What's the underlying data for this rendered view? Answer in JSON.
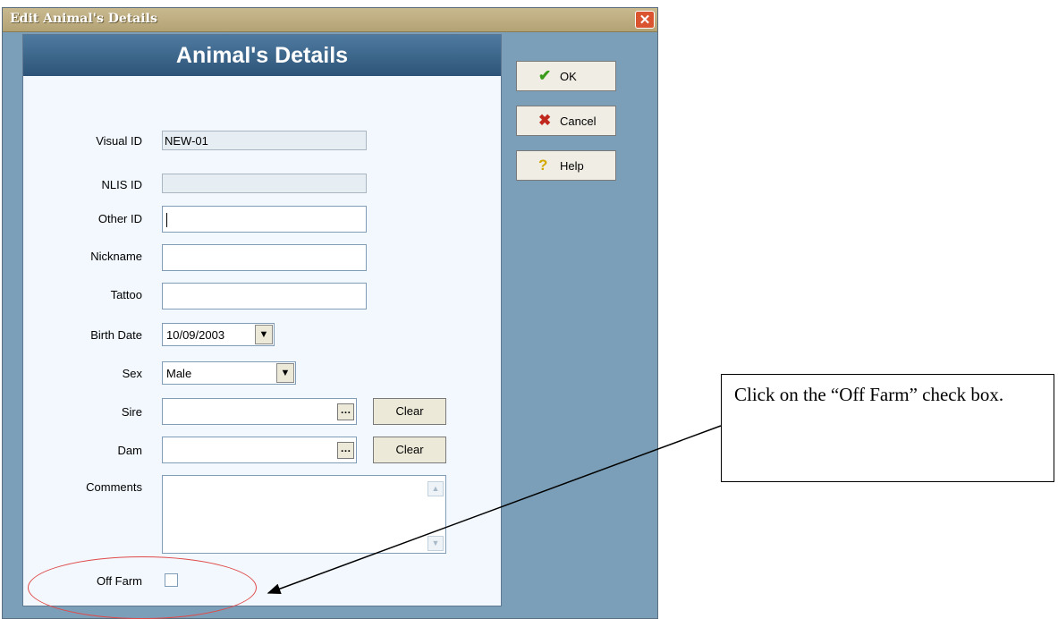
{
  "window": {
    "title": "Edit Animal's Details",
    "close_icon": "close-icon"
  },
  "panel": {
    "header": "Animal's Details",
    "fields": {
      "visual_id": {
        "label": "Visual ID",
        "value": "NEW-01"
      },
      "nlis_id": {
        "label": "NLIS ID",
        "value": ""
      },
      "other_id": {
        "label": "Other ID",
        "value": ""
      },
      "nickname": {
        "label": "Nickname",
        "value": ""
      },
      "tattoo": {
        "label": "Tattoo",
        "value": ""
      },
      "birth_date": {
        "label": "Birth Date",
        "value": "10/09/2003"
      },
      "sex": {
        "label": "Sex",
        "value": "Male"
      },
      "sire": {
        "label": "Sire",
        "value": "",
        "clear_label": "Clear"
      },
      "dam": {
        "label": "Dam",
        "value": "",
        "clear_label": "Clear"
      },
      "comments": {
        "label": "Comments",
        "value": ""
      },
      "off_farm": {
        "label": "Off Farm",
        "checked": false
      }
    }
  },
  "buttons": {
    "ok": {
      "label": "OK",
      "icon": "checkmark-icon"
    },
    "cancel": {
      "label": "Cancel",
      "icon": "x-icon"
    },
    "help": {
      "label": "Help",
      "icon": "help-icon"
    }
  },
  "annotation": {
    "callout_text": "Click on the “Off Farm” check box."
  },
  "colors": {
    "window_bg": "#7b9fb8",
    "header_bg": "#2d5478",
    "title_bar": "#b3a274",
    "highlight_ellipse": "#e04a4a"
  }
}
